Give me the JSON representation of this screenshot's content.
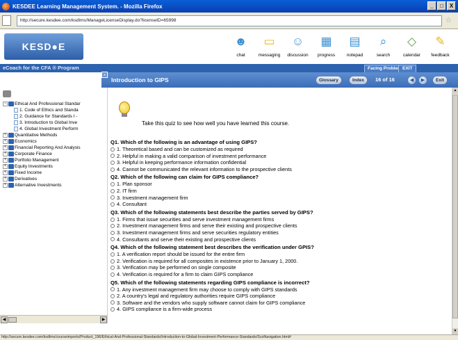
{
  "window": {
    "title": "KESDEE Learning Management System. - Mozilla Firefox",
    "controls": [
      "_",
      "□",
      "X"
    ]
  },
  "address": {
    "url": "http://secure.kesdee.com/ksdlms/ManageLicenseDisplay.do?licenseID=65998"
  },
  "header": {
    "logo": "KESD●E",
    "tools": [
      {
        "label": "chat",
        "icon": "chat-icon"
      },
      {
        "label": "messaging",
        "icon": "messaging-icon"
      },
      {
        "label": "discussion",
        "icon": "discussion-icon"
      },
      {
        "label": "progress",
        "icon": "progress-icon"
      },
      {
        "label": "notepad",
        "icon": "notepad-icon"
      },
      {
        "label": "search",
        "icon": "search-icon"
      },
      {
        "label": "calendar",
        "icon": "calendar-icon"
      },
      {
        "label": "feedback",
        "icon": "feedback-icon"
      }
    ]
  },
  "topbar": {
    "program": "eCoach for the CFA ® Program",
    "facing": "Facing Problem?",
    "exit": "EXIT"
  },
  "course": {
    "title": "Introduction to GIPS",
    "glossary": "Glossary",
    "index": "Index",
    "page": "16 of 16",
    "exit": "Exit"
  },
  "sidebar": {
    "root": "Ethical And Professional Standar",
    "children": [
      "1. Code of Ethics and Standa",
      "2. Guidance for Standards I -",
      "3. Introduction to Global Inve",
      "4. Global Investment Perform"
    ],
    "items": [
      "Quantitative Methods",
      "Economics",
      "Financial Reporting And Analysis",
      "Corporate Finance",
      "Portfolio Management",
      "Equity Investments",
      "Fixed Income",
      "Derivatives",
      "Alternative Investments"
    ]
  },
  "quiz": {
    "intro": "Take this quiz to see how well you have learned this course.",
    "questions": [
      {
        "q": "Q1. Which of the following is an advantage of using GIPS?",
        "options": [
          "1. Theoretical based and can be customized as required",
          "2. Helpful in making a valid comparison of investment performance",
          "3. Helpful in keeping performance information confidential",
          "4. Cannot be communicated the relevant information to the prospective clients"
        ]
      },
      {
        "q": "Q2. Which of the following can claim for GIPS compliance?",
        "options": [
          "1. Plan sponsor",
          "2. IT firm",
          "3. Investment management firm",
          "4. Consultant"
        ]
      },
      {
        "q": "Q3. Which of the following statements best describe the parties served by GIPS?",
        "options": [
          "1. Firms that issue securities and serve investment management firms",
          "2. Investment management firms and serve their existing and prospective clients",
          "3. Investment management firms and serve securities regulatory entities",
          "4. Consultants and serve their existing and prospective clients"
        ]
      },
      {
        "q": "Q4. Which of the following statement best describes the verification under GPIS?",
        "options": [
          "1. A verification report should be issued for the entire firm",
          "2. Verification is required for all composites in existence prior to January 1, 2000.",
          "3. Verification may be performed on single composite",
          "4. Verification is required for a firm to claim GIPS compliance"
        ]
      },
      {
        "q": "Q5. Which of the following statements regarding GIPS compliance is incorrect?",
        "options": [
          "1. Any investment management firm may choose to comply with GIPS standards",
          "2. A country's legal and regulatory authorities require GIPS compliance",
          "3. Software and the vendors who supply software cannot claim for GIPS compliance",
          "4. GIPS compliance is a firm-wide process"
        ]
      }
    ]
  },
  "status": {
    "text": "http://secure.kesdee.com/ksdlms/courseimports/Product_196/Ethical-And-Professional-Standards/Introduction-to-Global-Investment-Performance-Standards/ScoNavigation.html#"
  }
}
